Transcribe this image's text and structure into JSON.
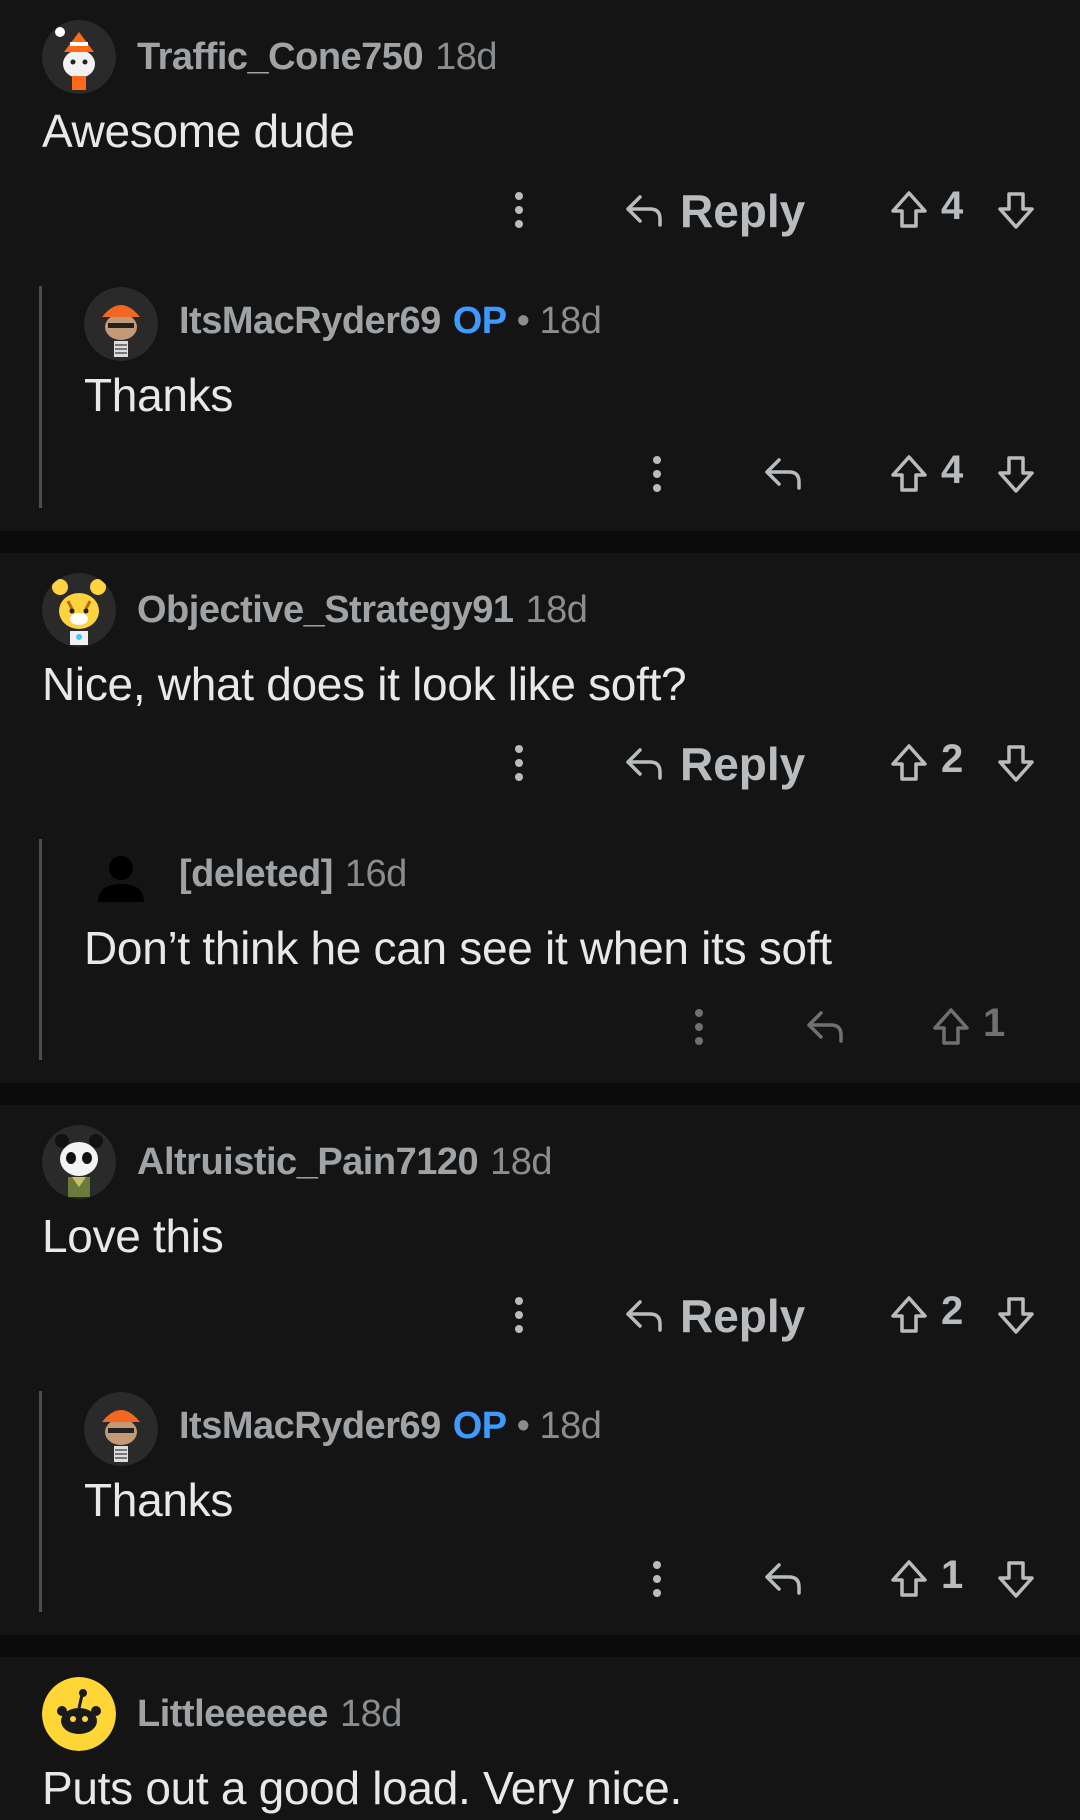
{
  "threads": [
    {
      "comment": {
        "username": "Traffic_Cone750",
        "time": "18d",
        "text": "Awesome dude",
        "reply_label": "Reply",
        "score": "4",
        "avatar_icon": "traffic-cone-snoo-avatar-icon"
      },
      "reply": {
        "username": "ItsMacRyder69",
        "op_badge": "OP",
        "dot": "•",
        "time": "18d",
        "text": "Thanks",
        "score": "4",
        "avatar_icon": "snoo-skeleton-avatar-icon"
      }
    },
    {
      "comment": {
        "username": "Objective_Strategy91",
        "time": "18d",
        "text": "Nice, what does it look like soft?",
        "reply_label": "Reply",
        "score": "2",
        "avatar_icon": "tiger-snoo-avatar-icon"
      },
      "reply": {
        "username": "[deleted]",
        "time": "16d",
        "text": "Don’t think he can see it when its soft",
        "score": "1",
        "avatar_icon": "deleted-user-avatar-icon"
      }
    },
    {
      "comment": {
        "username": "Altruistic_Pain7120",
        "time": "18d",
        "text": "Love this",
        "reply_label": "Reply",
        "score": "2",
        "avatar_icon": "panda-snoo-avatar-icon"
      },
      "reply": {
        "username": "ItsMacRyder69",
        "op_badge": "OP",
        "dot": "•",
        "time": "18d",
        "text": "Thanks",
        "score": "1",
        "avatar_icon": "snoo-skeleton-avatar-icon"
      }
    },
    {
      "comment": {
        "username": "Littleeeeee",
        "time": "18d",
        "text": "Puts out a good load. Very nice.",
        "avatar_icon": "default-yellow-snoo-avatar-icon"
      }
    }
  ],
  "colors": {
    "background": "#141414",
    "separator": "#0b0b0b",
    "username": "#a0a3a6",
    "op_badge": "#3d9bff",
    "body_text": "#e6e8ea",
    "icon": "#b9bcbf"
  }
}
